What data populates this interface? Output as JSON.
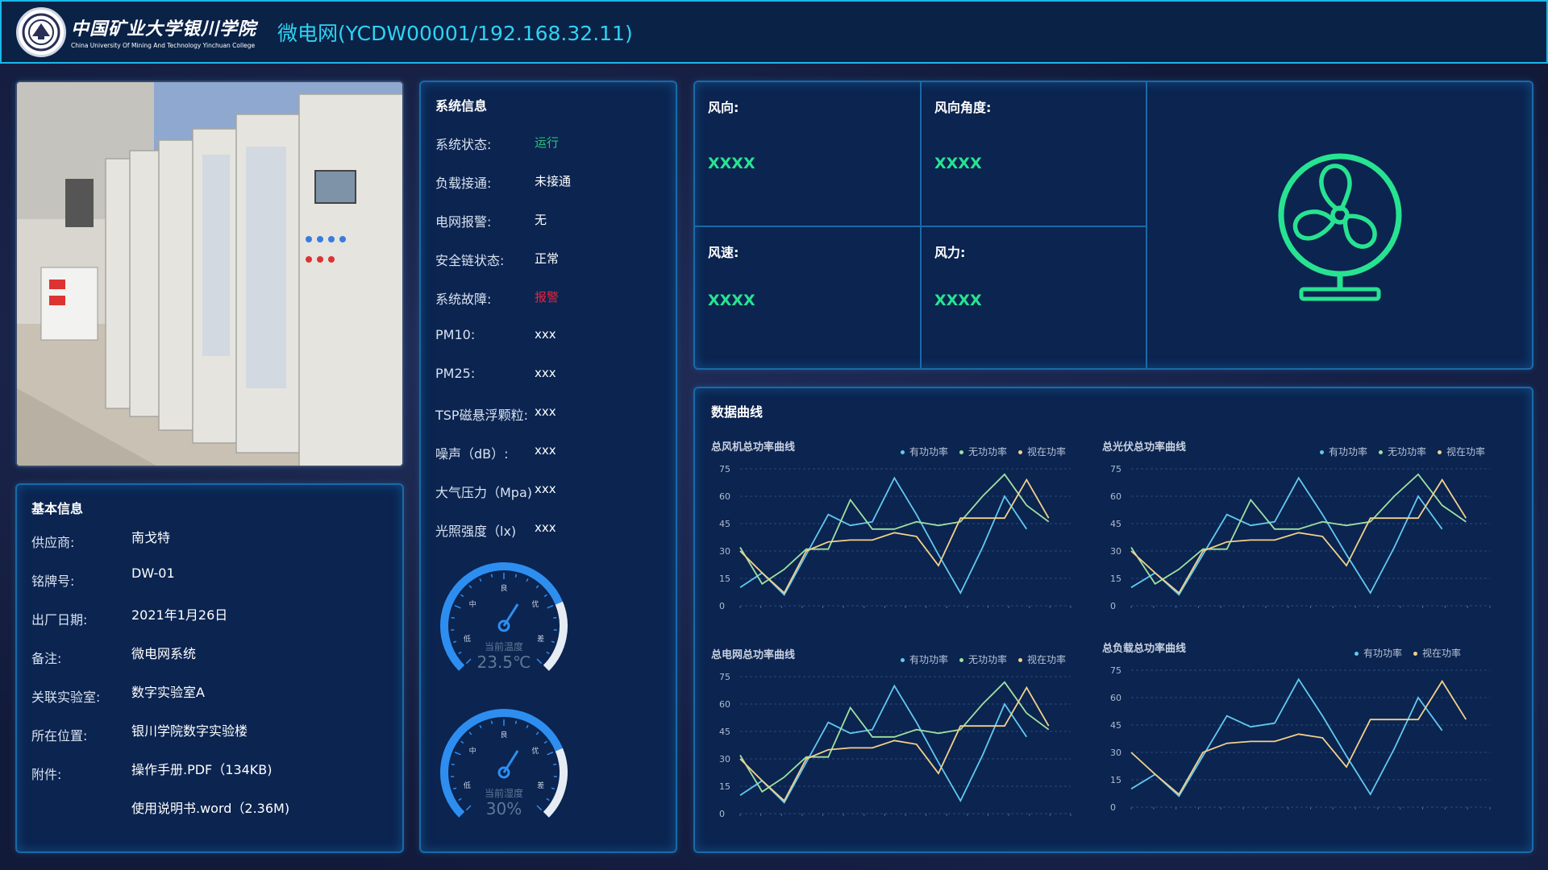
{
  "header": {
    "school_cn": "中国矿业大学银川学院",
    "school_en": "China University Of Mining And Technology Yinchuan College",
    "title": "微电网(YCDW00001/192.168.32.11)"
  },
  "basic_info": {
    "title": "基本信息",
    "rows": [
      {
        "label": "供应商:",
        "value": "南戈特"
      },
      {
        "label": "铭牌号:",
        "value": "DW-01"
      },
      {
        "label": "出厂日期:",
        "value": "2021年1月26日"
      },
      {
        "label": "备注:",
        "value": "微电网系统"
      },
      {
        "label": "关联实验室:",
        "value": "数字实验室A"
      },
      {
        "label": "所在位置:",
        "value": "银川学院数字实验楼"
      },
      {
        "label": "附件:",
        "value": "操作手册.PDF（134KB)"
      },
      {
        "label": "",
        "value": "使用说明书.word（2.36M)"
      }
    ]
  },
  "system_info": {
    "title": "系统信息",
    "rows": [
      {
        "label": "系统状态:",
        "value": "运行",
        "color": "#27c37a"
      },
      {
        "label": "负载接通:",
        "value": "未接通",
        "color": "#ffffff"
      },
      {
        "label": "电网报警:",
        "value": "无",
        "color": "#ffffff"
      },
      {
        "label": "安全链状态:",
        "value": "正常",
        "color": "#ffffff"
      },
      {
        "label": "系统故障:",
        "value": "报警",
        "color": "#e8243c"
      },
      {
        "label": "PM10:",
        "value": "xxx",
        "color": "#ffffff"
      },
      {
        "label": "PM25:",
        "value": "xxx",
        "color": "#ffffff"
      },
      {
        "label": "TSP磁悬浮颗粒:",
        "value": "xxx",
        "color": "#ffffff"
      },
      {
        "label": "噪声（dB）:",
        "value": "xxx",
        "color": "#ffffff"
      },
      {
        "label": "大气压力（Mpa)",
        "value": "xxx",
        "color": "#ffffff"
      },
      {
        "label": "光照强度（lx)",
        "value": "xxx",
        "color": "#ffffff"
      }
    ],
    "gauges": [
      {
        "caption": "当前温度",
        "value": "23.5℃",
        "marks": [
          "低",
          "中",
          "良",
          "优",
          "差"
        ]
      },
      {
        "caption": "当前湿度",
        "value": "30%",
        "marks": [
          "低",
          "中",
          "良",
          "优",
          "差"
        ]
      }
    ]
  },
  "wind": {
    "cells": [
      {
        "label": "风向:",
        "value": "XXXX"
      },
      {
        "label": "风向角度:",
        "value": "XXXX"
      },
      {
        "label": "风速:",
        "value": "XXXX"
      },
      {
        "label": "风力:",
        "value": "XXXX"
      }
    ],
    "icon": "fan-icon",
    "accent": "#27e391"
  },
  "charts_panel": {
    "title": "数据曲线"
  },
  "chart_data": [
    {
      "type": "line",
      "title": "总风机总功率曲线",
      "ylim": [
        0,
        75
      ],
      "yticks": [
        0,
        15,
        30,
        45,
        60,
        75
      ],
      "x": [
        0,
        1,
        2,
        3,
        4,
        5,
        6,
        7,
        8,
        9,
        10,
        11,
        12,
        13,
        14,
        15
      ],
      "series": [
        {
          "name": "有功功率",
          "color": "#62c9f0",
          "values": [
            10,
            18,
            6,
            28,
            50,
            44,
            46,
            70,
            50,
            28,
            7,
            32,
            60,
            42,
            null,
            null
          ]
        },
        {
          "name": "无功功率",
          "color": "#9fe0a0",
          "values": [
            32,
            12,
            20,
            31,
            31,
            58,
            42,
            42,
            46,
            44,
            46,
            60,
            72,
            55,
            46,
            null
          ]
        },
        {
          "name": "视在功率",
          "color": "#f3d08a",
          "values": [
            30,
            18,
            7,
            30,
            35,
            36,
            36,
            40,
            38,
            22,
            48,
            48,
            48,
            69,
            48,
            null
          ]
        }
      ]
    },
    {
      "type": "line",
      "title": "总光伏总功率曲线",
      "ylim": [
        0,
        75
      ],
      "yticks": [
        0,
        15,
        30,
        45,
        60,
        75
      ],
      "x": [
        0,
        1,
        2,
        3,
        4,
        5,
        6,
        7,
        8,
        9,
        10,
        11,
        12,
        13,
        14,
        15
      ],
      "series": [
        {
          "name": "有功功率",
          "color": "#62c9f0",
          "values": [
            10,
            18,
            6,
            28,
            50,
            44,
            46,
            70,
            50,
            28,
            7,
            32,
            60,
            42,
            null,
            null
          ]
        },
        {
          "name": "无功功率",
          "color": "#9fe0a0",
          "values": [
            32,
            12,
            20,
            31,
            31,
            58,
            42,
            42,
            46,
            44,
            46,
            60,
            72,
            55,
            46,
            null
          ]
        },
        {
          "name": "视在功率",
          "color": "#f3d08a",
          "values": [
            30,
            18,
            7,
            30,
            35,
            36,
            36,
            40,
            38,
            22,
            48,
            48,
            48,
            69,
            48,
            null
          ]
        }
      ]
    },
    {
      "type": "line",
      "title": "总电网总功率曲线",
      "ylim": [
        0,
        75
      ],
      "yticks": [
        0,
        15,
        30,
        45,
        60,
        75
      ],
      "x": [
        0,
        1,
        2,
        3,
        4,
        5,
        6,
        7,
        8,
        9,
        10,
        11,
        12,
        13,
        14,
        15
      ],
      "series": [
        {
          "name": "有功功率",
          "color": "#62c9f0",
          "values": [
            10,
            18,
            6,
            28,
            50,
            44,
            46,
            70,
            50,
            28,
            7,
            32,
            60,
            42,
            null,
            null
          ]
        },
        {
          "name": "无功功率",
          "color": "#9fe0a0",
          "values": [
            32,
            12,
            20,
            31,
            31,
            58,
            42,
            42,
            46,
            44,
            46,
            60,
            72,
            55,
            46,
            null
          ]
        },
        {
          "name": "视在功率",
          "color": "#f3d08a",
          "values": [
            30,
            18,
            7,
            30,
            35,
            36,
            36,
            40,
            38,
            22,
            48,
            48,
            48,
            69,
            48,
            null
          ]
        }
      ]
    },
    {
      "type": "line",
      "title": "总负载总功率曲线",
      "ylim": [
        0,
        75
      ],
      "yticks": [
        0,
        15,
        30,
        45,
        60,
        75
      ],
      "x": [
        0,
        1,
        2,
        3,
        4,
        5,
        6,
        7,
        8,
        9,
        10,
        11,
        12,
        13,
        14,
        15
      ],
      "series": [
        {
          "name": "有功功率",
          "color": "#62c9f0",
          "values": [
            10,
            18,
            6,
            28,
            50,
            44,
            46,
            70,
            50,
            28,
            7,
            32,
            60,
            42,
            null,
            null
          ]
        },
        {
          "name": "视在功率",
          "color": "#f3d08a",
          "values": [
            30,
            18,
            7,
            30,
            35,
            36,
            36,
            40,
            38,
            22,
            48,
            48,
            48,
            69,
            48,
            null
          ]
        }
      ]
    }
  ]
}
